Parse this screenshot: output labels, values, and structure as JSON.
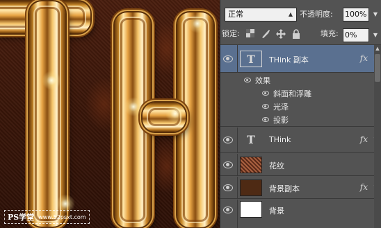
{
  "blend": {
    "mode": "正常",
    "opacity_label": "不透明度:",
    "opacity_value": "100%"
  },
  "lock": {
    "label": "锁定:",
    "fill_label": "填充:",
    "fill_value": "0%"
  },
  "layers": [
    {
      "name": "THink 副本",
      "thumb": "text",
      "fx": "fx",
      "selected": true,
      "effects_header": "效果",
      "effects": [
        "斜面和浮雕",
        "光泽",
        "投影"
      ]
    },
    {
      "name": "THink",
      "thumb": "text",
      "fx": "fx"
    },
    {
      "name": "花纹",
      "thumb": "pattern"
    },
    {
      "name": "背景副本",
      "thumb": "brown",
      "fx": "fx"
    },
    {
      "name": "背景",
      "thumb": "white"
    }
  ],
  "canvas": {
    "letters": [
      "T",
      "H"
    ]
  },
  "watermark": {
    "text": "PS学堂",
    "url": "www.52psxt.com"
  },
  "icons": {
    "visibility": "eye-icon",
    "lock_transparent": "checkerboard-icon",
    "lock_image": "brush-icon",
    "lock_position": "move-icon",
    "lock_all": "padlock-icon"
  },
  "colors": {
    "panel_bg": "#535353",
    "selected_row": "#5a7090",
    "gold": "#e7a445",
    "canvas_bg": "#3a1609"
  }
}
